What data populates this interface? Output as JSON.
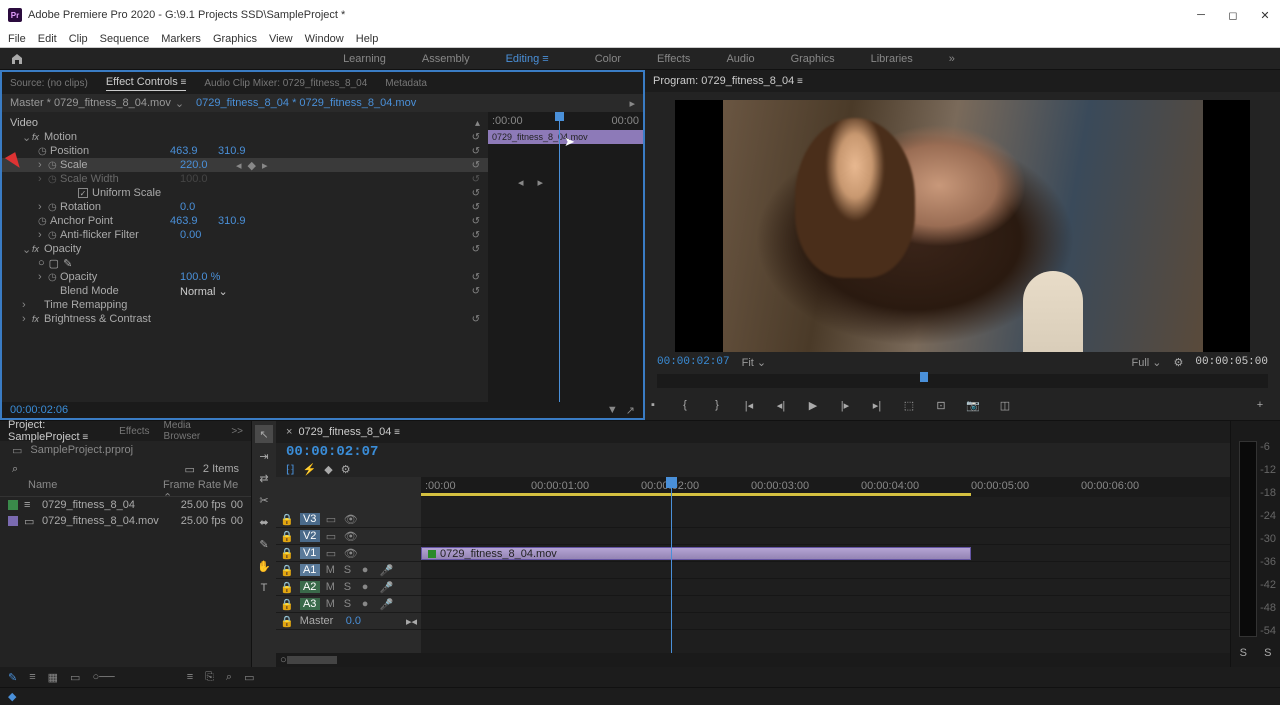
{
  "titlebar": {
    "app_abbr": "Pr",
    "title": "Adobe Premiere Pro 2020 - G:\\9.1 Projects SSD\\SampleProject *"
  },
  "menu": [
    "File",
    "Edit",
    "Clip",
    "Sequence",
    "Markers",
    "Graphics",
    "View",
    "Window",
    "Help"
  ],
  "workspaces": {
    "items": [
      "Learning",
      "Assembly",
      "Editing",
      "Color",
      "Effects",
      "Audio",
      "Graphics",
      "Libraries"
    ],
    "active": "Editing"
  },
  "source_panel": {
    "tabs": [
      "Source: (no clips)",
      "Effect Controls",
      "Audio Clip Mixer: 0729_fitness_8_04",
      "Metadata"
    ],
    "active_tab": "Effect Controls"
  },
  "effect_controls": {
    "master_label": "Master * 0729_fitness_8_04.mov",
    "clip_label": "0729_fitness_8_04 * 0729_fitness_8_04.mov",
    "video_label": "Video",
    "timeline": {
      "start": ":00:00",
      "end": "00:00",
      "clip_name": "0729_fitness_8_04.mov"
    },
    "motion": {
      "label": "Motion",
      "position": {
        "label": "Position",
        "x": "463.9",
        "y": "310.9"
      },
      "scale": {
        "label": "Scale",
        "value": "220.0"
      },
      "scale_width": {
        "label": "Scale Width",
        "value": "100.0"
      },
      "uniform_scale": {
        "label": "Uniform Scale",
        "checked": true
      },
      "rotation": {
        "label": "Rotation",
        "value": "0.0"
      },
      "anchor_point": {
        "label": "Anchor Point",
        "x": "463.9",
        "y": "310.9"
      },
      "anti_flicker": {
        "label": "Anti-flicker Filter",
        "value": "0.00"
      }
    },
    "opacity": {
      "label": "Opacity",
      "value_label": "Opacity",
      "value": "100.0 %",
      "blend_label": "Blend Mode",
      "blend_value": "Normal"
    },
    "time_remapping": {
      "label": "Time Remapping"
    },
    "brightness_contrast": {
      "label": "Brightness & Contrast"
    },
    "current_time": "00:00:02:06"
  },
  "program": {
    "tab": "Program: 0729_fitness_8_04",
    "current_tc": "00:00:02:07",
    "fit": "Fit",
    "resolution": "Full",
    "duration": "00:00:05:00"
  },
  "project": {
    "tabs": [
      "Project: SampleProject",
      "Effects",
      "Media Browser"
    ],
    "overflow": ">>",
    "name": "SampleProject.prproj",
    "items_count": "2 Items",
    "headers": {
      "name": "Name",
      "frame_rate": "Frame Rate",
      "media_start": "Me"
    },
    "items": [
      {
        "color": "#3a8a4a",
        "icon_type": "sequence",
        "name": "0729_fitness_8_04",
        "fps": "25.00 fps",
        "ms": "00"
      },
      {
        "color": "#7a6ab0",
        "icon_type": "clip",
        "name": "0729_fitness_8_04.mov",
        "fps": "25.00 fps",
        "ms": "00"
      }
    ]
  },
  "timeline": {
    "seq_name": "0729_fitness_8_04",
    "tc": "00:00:02:07",
    "ruler": [
      ":00:00",
      "00:00:01:00",
      "00:00:02:00",
      "00:00:03:00",
      "00:00:04:00",
      "00:00:05:00",
      "00:00:06:00"
    ],
    "video_tracks": [
      "V3",
      "V2",
      "V1"
    ],
    "audio_tracks": [
      "A1",
      "A2",
      "A3"
    ],
    "master": {
      "label": "Master",
      "value": "0.0"
    },
    "clip_name": "0729_fitness_8_04.mov"
  },
  "audio_meter": {
    "scale": [
      "-6",
      "-12",
      "-18",
      "-24",
      "-30",
      "-36",
      "-42",
      "-48",
      "-54"
    ],
    "solo": [
      "S",
      "S"
    ]
  }
}
